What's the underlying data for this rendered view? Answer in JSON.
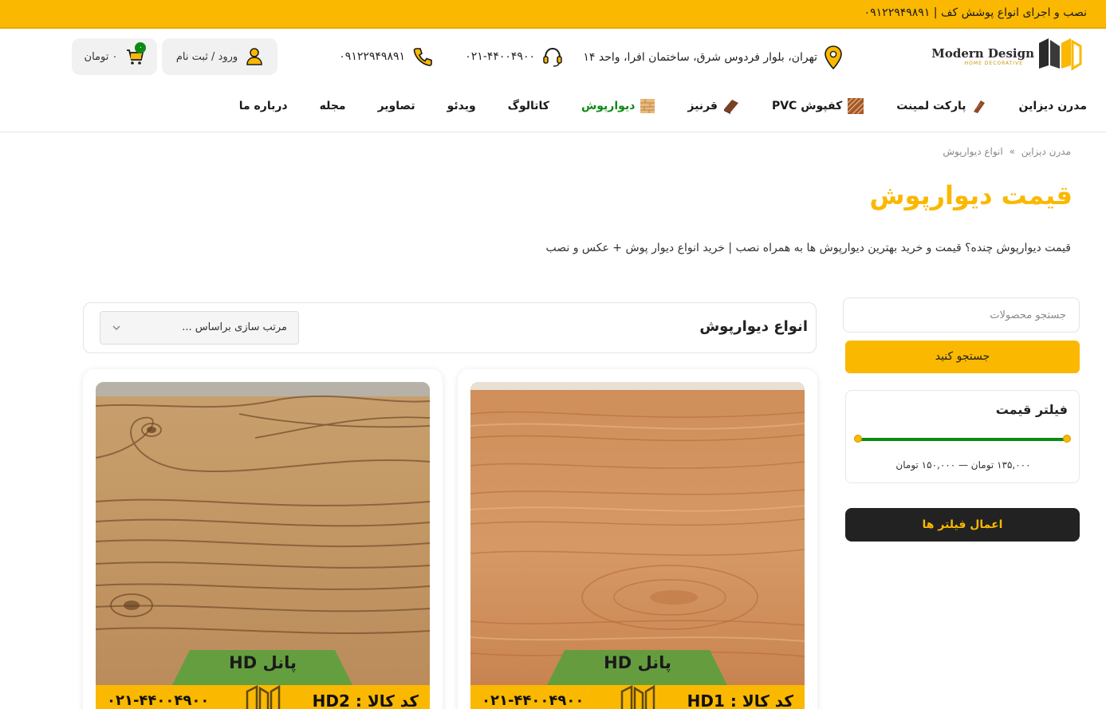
{
  "topbar": {
    "text": "نصب و اجرای انواع پوشش کف | ۰۹۱۲۲۹۴۹۸۹۱"
  },
  "logo": {
    "name": "Modern Design",
    "tagline": "HOME DECORATIVE"
  },
  "contacts": {
    "address": "تهران، بلوار فردوس شرق، ساختمان افرا، واحد ۱۴",
    "phone_landline": "۰۲۱-۴۴۰۰۴۹۰۰",
    "phone_mobile": "۰۹۱۲۲۹۴۹۸۹۱"
  },
  "account": {
    "login_label": "ورود / ثبت نام"
  },
  "cart": {
    "label": "۰ تومان",
    "count": "۰"
  },
  "nav": {
    "items": [
      {
        "label": "مدرن دیزاین",
        "icon": ""
      },
      {
        "label": "پارکت لمینت",
        "icon": "parquet-icon"
      },
      {
        "label": "کفپوش PVC",
        "icon": "pvc-icon"
      },
      {
        "label": "قرنیز",
        "icon": "plinth-icon"
      },
      {
        "label": "دیوارپوش",
        "icon": "wall-panel-icon",
        "active": true
      },
      {
        "label": "کاتالوگ",
        "icon": ""
      },
      {
        "label": "ویدئو",
        "icon": ""
      },
      {
        "label": "تصاویر",
        "icon": ""
      },
      {
        "label": "مجله",
        "icon": ""
      },
      {
        "label": "درباره ما",
        "icon": ""
      }
    ]
  },
  "breadcrumb": {
    "home": "مدرن دیزاین",
    "separator": "»",
    "current": "انواع دیوارپوش"
  },
  "page": {
    "title": "قیمت دیوارپوش",
    "description": "قیمت دیوارپوش چنده؟ قیمت و خرید بهترین دیوارپوش ها به همراه نصب | خرید انواع دیوار پوش + عکس و نصب"
  },
  "sidebar": {
    "search_placeholder": "جستجو محصولات",
    "search_button": "جستجو کنید",
    "filter_title": "فیلتر قیمت",
    "price_range_text": "۱۳۵,۰۰۰ تومان — ۱۵۰,۰۰۰ تومان",
    "price_min": 135000,
    "price_max": 150000,
    "apply_button": "اعمال فیلتر ها"
  },
  "products": {
    "heading": "انواع دیوارپوش",
    "sort_label": "مرتب سازی براساس ...",
    "items": [
      {
        "badge": "پانل HD",
        "code": "کد کالا : HD1",
        "phone": "۰۲۱-۴۴۰۰۴۹۰۰"
      },
      {
        "badge": "پانل HD",
        "code": "کد کالا : HD2",
        "phone": "۰۲۱-۴۴۰۰۴۹۰۰"
      }
    ]
  },
  "colors": {
    "accent": "#fbb800",
    "active_nav": "#0e8a14",
    "dark": "#222222"
  }
}
